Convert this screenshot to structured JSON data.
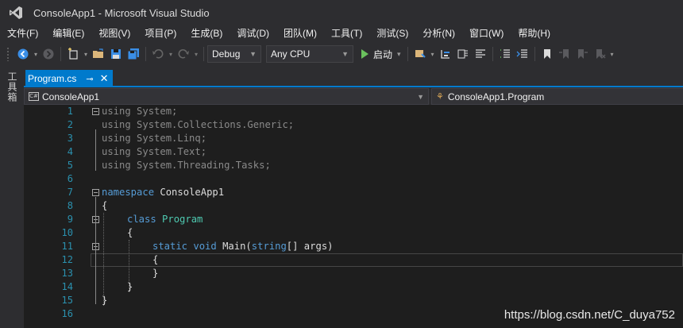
{
  "window": {
    "title": "ConsoleApp1 - Microsoft Visual Studio",
    "logo_icon": "visual-studio-logo-icon"
  },
  "menu": {
    "items": [
      {
        "label": "文件(F)"
      },
      {
        "label": "编辑(E)"
      },
      {
        "label": "视图(V)"
      },
      {
        "label": "项目(P)"
      },
      {
        "label": "生成(B)"
      },
      {
        "label": "调试(D)"
      },
      {
        "label": "团队(M)"
      },
      {
        "label": "工具(T)"
      },
      {
        "label": "测试(S)"
      },
      {
        "label": "分析(N)"
      },
      {
        "label": "窗口(W)"
      },
      {
        "label": "帮助(H)"
      }
    ]
  },
  "toolbar": {
    "configuration": "Debug",
    "platform": "Any CPU",
    "start_label": "启动"
  },
  "sidebar": {
    "toolbox_label": "工具箱"
  },
  "document_tab": {
    "label": "Program.cs",
    "pin_icon": "pin-icon",
    "close_icon": "close-icon"
  },
  "navigation": {
    "project": "ConsoleApp1",
    "type": "ConsoleApp1.Program"
  },
  "editor": {
    "line_numbers": [
      "1",
      "2",
      "3",
      "4",
      "5",
      "6",
      "7",
      "8",
      "9",
      "10",
      "11",
      "12",
      "13",
      "14",
      "15",
      "16"
    ],
    "lines": [
      {
        "indent": 0,
        "tokens": [
          {
            "t": "using",
            "c": "dim"
          },
          {
            "t": " System;",
            "c": "dim"
          }
        ]
      },
      {
        "indent": 0,
        "tokens": [
          {
            "t": "using",
            "c": "dim"
          },
          {
            "t": " System.Collections.Generic;",
            "c": "dim"
          }
        ]
      },
      {
        "indent": 0,
        "tokens": [
          {
            "t": "using",
            "c": "dim"
          },
          {
            "t": " System.Linq;",
            "c": "dim"
          }
        ]
      },
      {
        "indent": 0,
        "tokens": [
          {
            "t": "using",
            "c": "dim"
          },
          {
            "t": " System.Text;",
            "c": "dim"
          }
        ]
      },
      {
        "indent": 0,
        "tokens": [
          {
            "t": "using",
            "c": "dim"
          },
          {
            "t": " System.Threading.Tasks;",
            "c": "dim"
          }
        ]
      },
      {
        "indent": 0,
        "tokens": []
      },
      {
        "indent": 0,
        "tokens": [
          {
            "t": "namespace",
            "c": "kw"
          },
          {
            "t": " ConsoleApp1",
            "c": ""
          }
        ]
      },
      {
        "indent": 0,
        "tokens": [
          {
            "t": "{",
            "c": ""
          }
        ]
      },
      {
        "indent": 1,
        "tokens": [
          {
            "t": "class",
            "c": "kw"
          },
          {
            "t": " ",
            "c": ""
          },
          {
            "t": "Program",
            "c": "ty"
          }
        ]
      },
      {
        "indent": 1,
        "tokens": [
          {
            "t": "{",
            "c": ""
          }
        ]
      },
      {
        "indent": 2,
        "tokens": [
          {
            "t": "static",
            "c": "kw"
          },
          {
            "t": " ",
            "c": ""
          },
          {
            "t": "void",
            "c": "kw"
          },
          {
            "t": " Main(",
            "c": ""
          },
          {
            "t": "string",
            "c": "kw"
          },
          {
            "t": "[] args)",
            "c": ""
          }
        ]
      },
      {
        "indent": 2,
        "tokens": [
          {
            "t": "{",
            "c": ""
          }
        ]
      },
      {
        "indent": 2,
        "tokens": [
          {
            "t": "}",
            "c": ""
          }
        ]
      },
      {
        "indent": 1,
        "tokens": [
          {
            "t": "}",
            "c": ""
          }
        ]
      },
      {
        "indent": 0,
        "tokens": [
          {
            "t": "}",
            "c": ""
          }
        ]
      },
      {
        "indent": 0,
        "tokens": []
      }
    ]
  },
  "watermark": "https://blog.csdn.net/C_duya752"
}
